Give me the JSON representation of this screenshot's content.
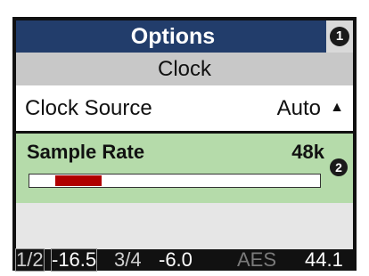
{
  "header": {
    "title": "Options",
    "badge": "1"
  },
  "section": {
    "title": "Clock"
  },
  "rows": [
    {
      "label": "Clock Source",
      "value": "Auto",
      "arrow_icon": "triangle-up-icon"
    },
    {
      "label": "Sample Rate",
      "value": "48k",
      "badge": "2",
      "bar_level_start": 0.09,
      "bar_level_end": 0.25
    }
  ],
  "status_bar": {
    "ch1_label": "1/2",
    "ch1_value": "-16.5",
    "ch2_label": "3/4",
    "ch2_value": "-6.0",
    "aes_label": "AES",
    "aes_value": "44.1"
  },
  "colors": {
    "title_bg": "#223d6b",
    "section_bg": "#c8c8c8",
    "selected_bg": "#b5dbaa",
    "bar_fill": "#b00000",
    "status_bg": "#111111"
  }
}
